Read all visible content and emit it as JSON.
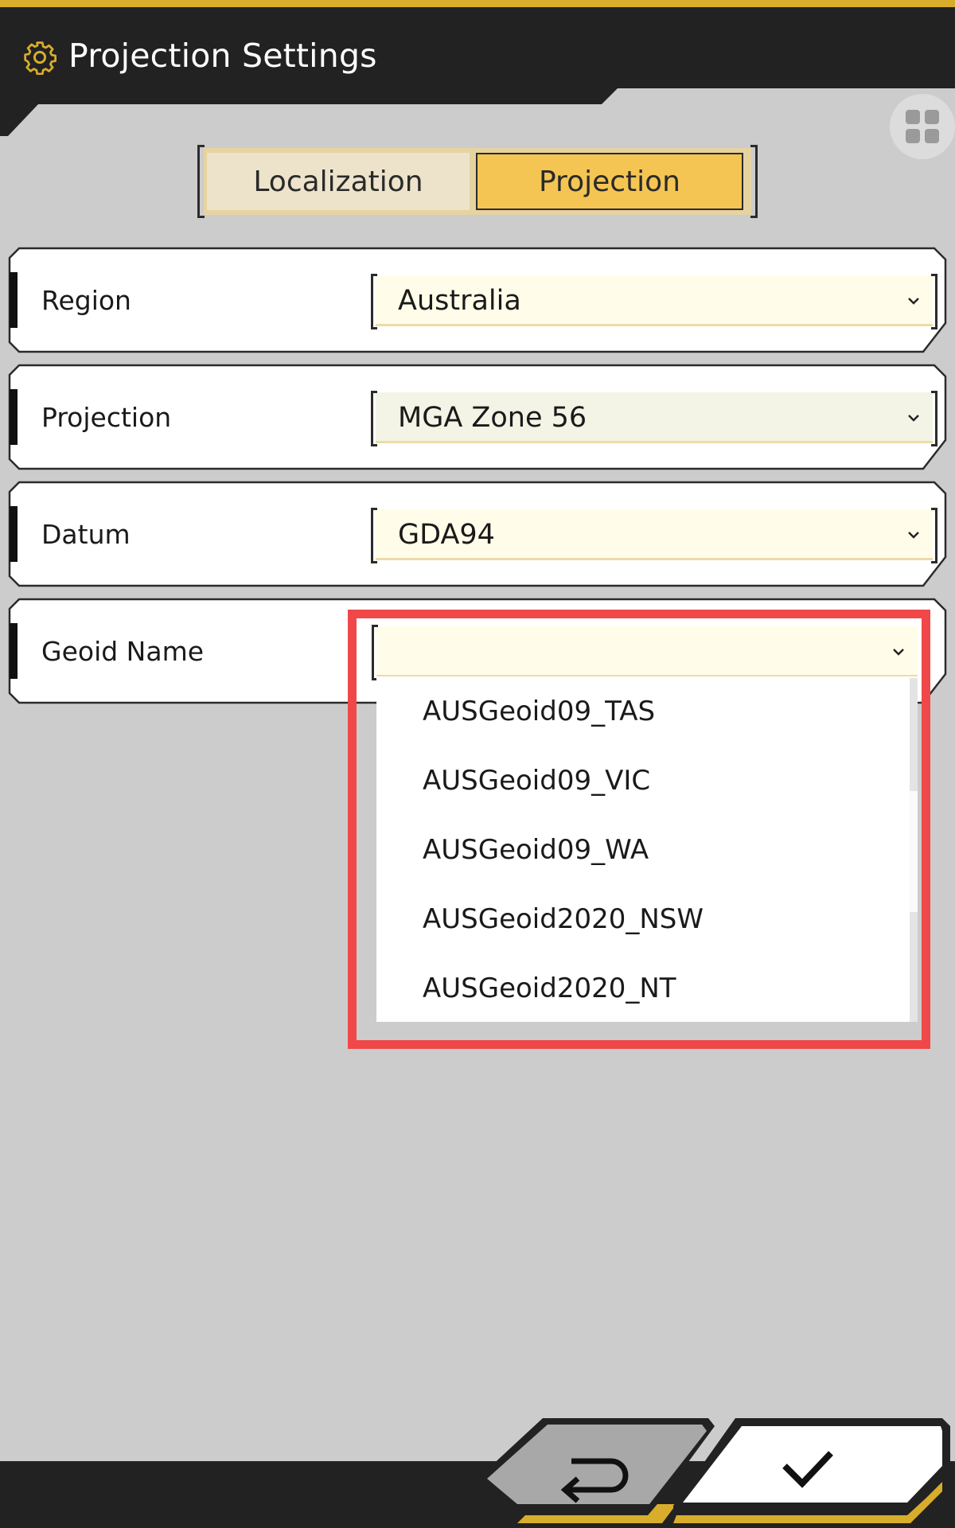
{
  "header": {
    "title": "Projection Settings",
    "icon": "gear-icon"
  },
  "apps_button": {
    "icon": "grid-icon"
  },
  "tabs": [
    {
      "label": "Localization",
      "active": false
    },
    {
      "label": "Projection",
      "active": true
    }
  ],
  "fields": {
    "region": {
      "label": "Region",
      "value": "Australia"
    },
    "projection": {
      "label": "Projection",
      "value": "MGA Zone 56"
    },
    "datum": {
      "label": "Datum",
      "value": "GDA94"
    },
    "geoid": {
      "label": "Geoid Name",
      "value": ""
    }
  },
  "geoid_options": [
    "AUSGeoid09_TAS",
    "AUSGeoid09_VIC",
    "AUSGeoid09_WA",
    "AUSGeoid2020_NSW",
    "AUSGeoid2020_NT"
  ],
  "footer": {
    "back_icon": "return-icon",
    "confirm_icon": "checkmark-icon"
  },
  "colors": {
    "accent_yellow": "#f5c553",
    "header_dark": "#222222",
    "highlight_red": "#f04848",
    "select_bg": "#fffde9"
  }
}
